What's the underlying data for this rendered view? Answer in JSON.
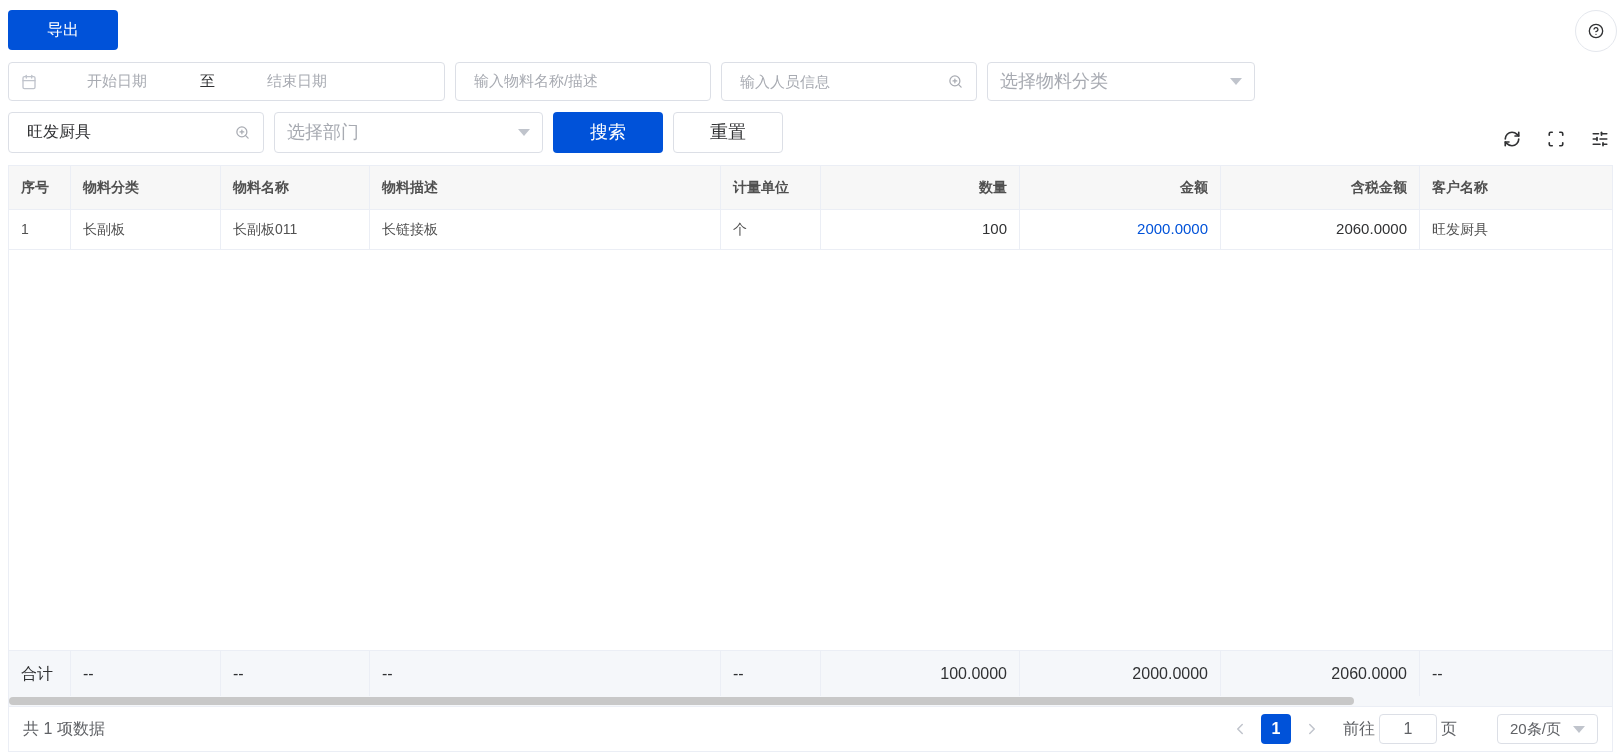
{
  "toolbar": {
    "export_button": "导出"
  },
  "filters": {
    "date_range": {
      "start_placeholder": "开始日期",
      "separator": "至",
      "end_placeholder": "结束日期"
    },
    "material": {
      "placeholder": "输入物料名称/描述"
    },
    "person": {
      "placeholder": "输入人员信息"
    },
    "category": {
      "placeholder": "选择物料分类"
    },
    "customer": {
      "value": "旺发厨具"
    },
    "department": {
      "placeholder": "选择部门"
    },
    "search_button": "搜索",
    "reset_button": "重置"
  },
  "table": {
    "columns": [
      {
        "label": "序号",
        "kind": "text"
      },
      {
        "label": "物料分类",
        "kind": "text"
      },
      {
        "label": "物料名称",
        "kind": "text"
      },
      {
        "label": "物料描述",
        "kind": "text"
      },
      {
        "label": "计量单位",
        "kind": "text"
      },
      {
        "label": "数量",
        "kind": "number"
      },
      {
        "label": "金额",
        "kind": "link"
      },
      {
        "label": "含税金额",
        "kind": "number"
      },
      {
        "label": "客户名称",
        "kind": "text"
      }
    ],
    "rows": [
      [
        "1",
        "长副板",
        "长副板011",
        "长链接板",
        "个",
        "100",
        "2000.0000",
        "2060.0000",
        "旺发厨具"
      ]
    ],
    "summary": [
      "合计",
      "--",
      "--",
      "--",
      "--",
      "100.0000",
      "2000.0000",
      "2060.0000",
      "--"
    ]
  },
  "footer": {
    "total": "共 1 项数据",
    "pages": [
      {
        "label": "1",
        "selected": true
      }
    ],
    "goto_label": "前往",
    "goto_value": "1",
    "page_unit": "页",
    "page_size": "20条/页"
  }
}
